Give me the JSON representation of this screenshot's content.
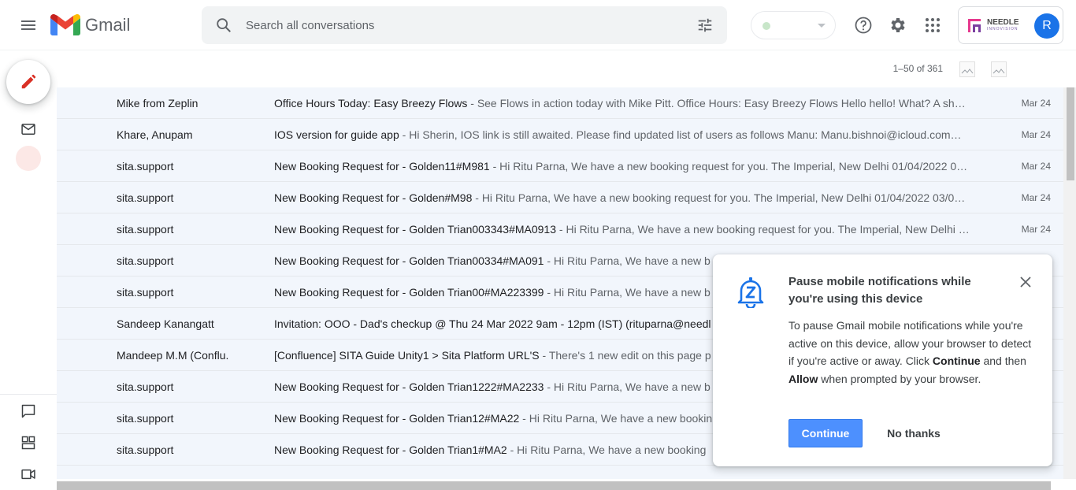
{
  "app": {
    "name": "Gmail"
  },
  "search": {
    "placeholder": "Search all conversations"
  },
  "account": {
    "org_logo_text": "NEEDLE",
    "org_logo_sub": "INNOVISION",
    "avatar_initial": "R"
  },
  "pager": {
    "range_text": "1–50 of 361"
  },
  "emails": [
    {
      "sender": "Mike from Zeplin",
      "subject": "Office Hours Today: Easy Breezy Flows",
      "snippet": "See Flows in action today with Mike Pitt. Office Hours: Easy Breezy Flows Hello hello! What? A sh…",
      "date": "Mar 24"
    },
    {
      "sender": "Khare, Anupam",
      "subject": "IOS version for guide app",
      "snippet": "Hi Sherin, IOS link is still awaited. Please find updated list of users as follows Manu: Manu.bishnoi@icloud.com…",
      "date": "Mar 24"
    },
    {
      "sender": "sita.support",
      "subject": "New Booking Request for - Golden11#M981",
      "snippet": "Hi Ritu Parna, We have a new booking request for you. The Imperial, New Delhi 01/04/2022 0…",
      "date": "Mar 24"
    },
    {
      "sender": "sita.support",
      "subject": "New Booking Request for - Golden#M98",
      "snippet": "Hi Ritu Parna, We have a new booking request for you. The Imperial, New Delhi 01/04/2022 03/0…",
      "date": "Mar 24"
    },
    {
      "sender": "sita.support",
      "subject": "New Booking Request for - Golden Trian003343#MA0913",
      "snippet": "Hi Ritu Parna, We have a new booking request for you. The Imperial, New Delhi …",
      "date": "Mar 24"
    },
    {
      "sender": "sita.support",
      "subject": "New Booking Request for - Golden Trian00334#MA091",
      "snippet": "Hi Ritu Parna, We have a new b",
      "date": ""
    },
    {
      "sender": "sita.support",
      "subject": "New Booking Request for - Golden Trian00#MA223399",
      "snippet": "Hi Ritu Parna, We have a new b",
      "date": ""
    },
    {
      "sender": "Sandeep Kanangatt",
      "subject": "Invitation: OOO - Dad's checkup @ Thu 24 Mar 2022 9am - 12pm (IST) (rituparna@needl",
      "snippet": "",
      "date": ""
    },
    {
      "sender": "Mandeep M.M (Conflu.",
      "subject": "[Confluence] SITA Guide Unity1 > Sita Platform URL'S",
      "snippet": "There's 1 new edit on this page p",
      "date": ""
    },
    {
      "sender": "sita.support",
      "subject": "New Booking Request for - Golden Trian1222#MA2233",
      "snippet": "Hi Ritu Parna, We have a new b",
      "date": ""
    },
    {
      "sender": "sita.support",
      "subject": "New Booking Request for - Golden Trian12#MA22",
      "snippet": "Hi Ritu Parna, We have a new bookin",
      "date": ""
    },
    {
      "sender": "sita.support",
      "subject": "New Booking Request for - Golden Trian1#MA2",
      "snippet": "Hi Ritu Parna, We have a new booking",
      "date": ""
    }
  ],
  "popup": {
    "title": "Pause mobile notifications while you're using this device",
    "body_1": "To pause Gmail mobile notifications while you're active on this device, allow your browser to detect if you're active or away. Click ",
    "body_continue": "Continue",
    "body_2": " and then ",
    "body_allow": "Allow",
    "body_3": " when prompted by your browser.",
    "continue_label": "Continue",
    "no_thanks_label": "No thanks"
  },
  "colors": {
    "accent": "#4d90fe",
    "avatar": "#1a73e8",
    "compose_pencil": "#d93025",
    "bell": "#1a73e8"
  }
}
